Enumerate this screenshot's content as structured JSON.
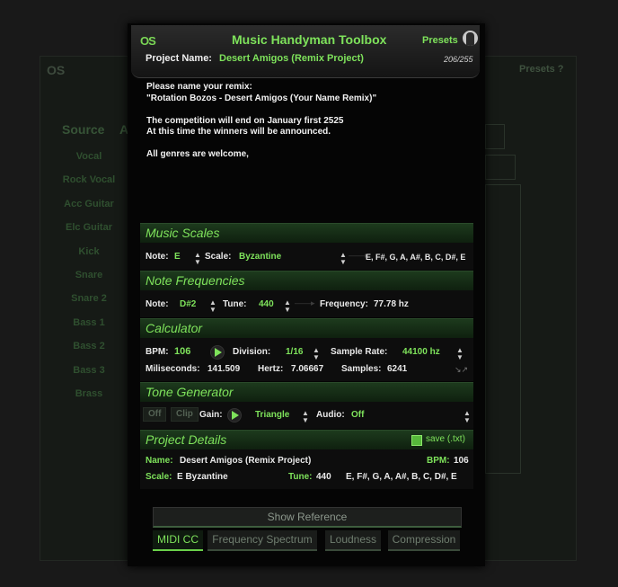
{
  "background": {
    "logo": "OS",
    "presets": "Presets  ?",
    "source_header": "Source",
    "second_header": "A",
    "tracks": [
      "Vocal",
      "Rock Vocal",
      "Acc Guitar",
      "Elc Guitar",
      "Kick",
      "Snare",
      "Snare 2",
      "Bass 1",
      "Bass 2",
      "Bass 3",
      "Brass"
    ]
  },
  "dialog": {
    "logo": "OS",
    "title": "Music Handyman Toolbox",
    "presets_label": "Presets",
    "project_label": "Project Name:",
    "project_name": "Desert Amigos (Remix Project)",
    "char_count": "206/255",
    "message": [
      "Please name your remix:",
      "\"Rotation Bozos - Desert Amigos (Your Name Remix)\"",
      "",
      "The competition will end on January first 2525",
      "At this time the winners will be announced.",
      "",
      "All genres are welcome,"
    ]
  },
  "music_scales": {
    "title": "Music Scales",
    "note_label": "Note:",
    "note_value": "E",
    "scale_label": "Scale:",
    "scale_value": "Byzantine",
    "notes_result": "E, F#, G, A, A#, B, C, D#, E"
  },
  "note_frequencies": {
    "title": "Note Frequencies",
    "note_label": "Note:",
    "note_value": "D#2",
    "tune_label": "Tune:",
    "tune_value": "440",
    "frequency_label": "Frequency:",
    "frequency_value": "77.78 hz"
  },
  "calculator": {
    "title": "Calculator",
    "bpm_label": "BPM:",
    "bpm_value": "106",
    "division_label": "Division:",
    "division_value": "1/16",
    "sample_rate_label": "Sample Rate:",
    "sample_rate_value": "44100 hz",
    "ms_label": "Miliseconds:",
    "ms_value": "141.509",
    "hertz_label": "Hertz:",
    "hertz_value": "7.06667",
    "samples_label": "Samples:",
    "samples_value": "6241"
  },
  "tone_generator": {
    "title": "Tone Generator",
    "off_label": "Off",
    "clip_label": "Clip",
    "gain_label": "Gain:",
    "wave_value": "Triangle",
    "audio_label": "Audio:",
    "audio_value": "Off"
  },
  "project_details": {
    "title": "Project Details",
    "save_label": "save (.txt)",
    "name_label": "Name:",
    "name_value": "Desert Amigos (Remix Project)",
    "bpm_label": "BPM:",
    "bpm_value": "106",
    "scale_label": "Scale:",
    "scale_value": "E Byzantine",
    "tune_label": "Tune:",
    "tune_value": "440",
    "notes_value": "E, F#, G, A, A#, B, C, D#, E"
  },
  "footer": {
    "show_reference": "Show Reference",
    "tabs": [
      "MIDI CC",
      "Frequency Spectrum",
      "Loudness",
      "Compression"
    ]
  },
  "colors": {
    "accent": "#7ee25b",
    "background": "#050505"
  }
}
